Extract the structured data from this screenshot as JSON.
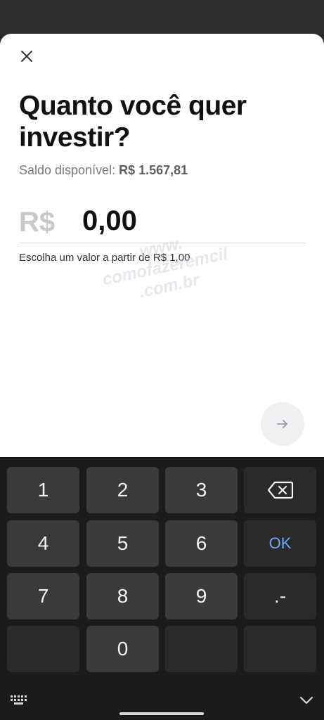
{
  "sheet": {
    "title": "Quanto você quer investir?",
    "balance_label": "Saldo disponível:",
    "balance_value": "R$ 1.567,81",
    "currency_symbol": "R$",
    "amount_value": "0,00",
    "helper_text": "Escolha um valor a partir de R$ 1,00",
    "watermark_line1": "www.",
    "watermark_line2": "comofazeremcil",
    "watermark_line3": ".com.br"
  },
  "keyboard": {
    "keys": {
      "k1": "1",
      "k2": "2",
      "k3": "3",
      "k4": "4",
      "k5": "5",
      "k6": "6",
      "k7": "7",
      "k8": "8",
      "k9": "9",
      "k0": "0",
      "ok": "OK",
      "dot_minus": ".-"
    }
  },
  "icons": {
    "close": "close-icon",
    "next": "arrow-right-icon",
    "backspace": "backspace-icon",
    "keyboard_switch": "keyboard-icon",
    "hide_keyboard": "chevron-down-icon"
  },
  "colors": {
    "ok_key": "#6ea8ff",
    "key_bg": "#3a3a3a",
    "keyboard_bg": "#1b1b1b"
  }
}
